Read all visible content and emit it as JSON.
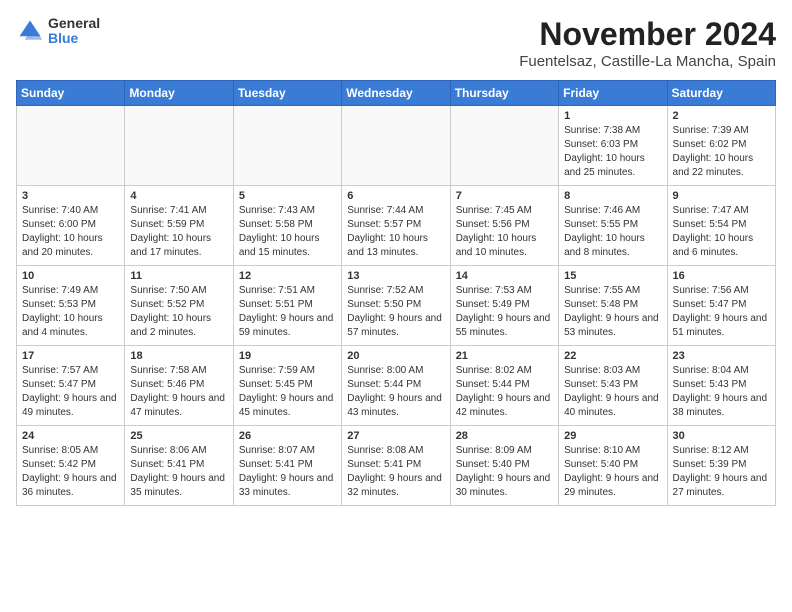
{
  "header": {
    "logo_general": "General",
    "logo_blue": "Blue",
    "month_title": "November 2024",
    "location": "Fuentelsaz, Castille-La Mancha, Spain"
  },
  "days_of_week": [
    "Sunday",
    "Monday",
    "Tuesday",
    "Wednesday",
    "Thursday",
    "Friday",
    "Saturday"
  ],
  "weeks": [
    [
      {
        "day": "",
        "info": "",
        "empty": true
      },
      {
        "day": "",
        "info": "",
        "empty": true
      },
      {
        "day": "",
        "info": "",
        "empty": true
      },
      {
        "day": "",
        "info": "",
        "empty": true
      },
      {
        "day": "",
        "info": "",
        "empty": true
      },
      {
        "day": "1",
        "info": "Sunrise: 7:38 AM\nSunset: 6:03 PM\nDaylight: 10 hours and 25 minutes."
      },
      {
        "day": "2",
        "info": "Sunrise: 7:39 AM\nSunset: 6:02 PM\nDaylight: 10 hours and 22 minutes."
      }
    ],
    [
      {
        "day": "3",
        "info": "Sunrise: 7:40 AM\nSunset: 6:00 PM\nDaylight: 10 hours and 20 minutes."
      },
      {
        "day": "4",
        "info": "Sunrise: 7:41 AM\nSunset: 5:59 PM\nDaylight: 10 hours and 17 minutes."
      },
      {
        "day": "5",
        "info": "Sunrise: 7:43 AM\nSunset: 5:58 PM\nDaylight: 10 hours and 15 minutes."
      },
      {
        "day": "6",
        "info": "Sunrise: 7:44 AM\nSunset: 5:57 PM\nDaylight: 10 hours and 13 minutes."
      },
      {
        "day": "7",
        "info": "Sunrise: 7:45 AM\nSunset: 5:56 PM\nDaylight: 10 hours and 10 minutes."
      },
      {
        "day": "8",
        "info": "Sunrise: 7:46 AM\nSunset: 5:55 PM\nDaylight: 10 hours and 8 minutes."
      },
      {
        "day": "9",
        "info": "Sunrise: 7:47 AM\nSunset: 5:54 PM\nDaylight: 10 hours and 6 minutes."
      }
    ],
    [
      {
        "day": "10",
        "info": "Sunrise: 7:49 AM\nSunset: 5:53 PM\nDaylight: 10 hours and 4 minutes."
      },
      {
        "day": "11",
        "info": "Sunrise: 7:50 AM\nSunset: 5:52 PM\nDaylight: 10 hours and 2 minutes."
      },
      {
        "day": "12",
        "info": "Sunrise: 7:51 AM\nSunset: 5:51 PM\nDaylight: 9 hours and 59 minutes."
      },
      {
        "day": "13",
        "info": "Sunrise: 7:52 AM\nSunset: 5:50 PM\nDaylight: 9 hours and 57 minutes."
      },
      {
        "day": "14",
        "info": "Sunrise: 7:53 AM\nSunset: 5:49 PM\nDaylight: 9 hours and 55 minutes."
      },
      {
        "day": "15",
        "info": "Sunrise: 7:55 AM\nSunset: 5:48 PM\nDaylight: 9 hours and 53 minutes."
      },
      {
        "day": "16",
        "info": "Sunrise: 7:56 AM\nSunset: 5:47 PM\nDaylight: 9 hours and 51 minutes."
      }
    ],
    [
      {
        "day": "17",
        "info": "Sunrise: 7:57 AM\nSunset: 5:47 PM\nDaylight: 9 hours and 49 minutes."
      },
      {
        "day": "18",
        "info": "Sunrise: 7:58 AM\nSunset: 5:46 PM\nDaylight: 9 hours and 47 minutes."
      },
      {
        "day": "19",
        "info": "Sunrise: 7:59 AM\nSunset: 5:45 PM\nDaylight: 9 hours and 45 minutes."
      },
      {
        "day": "20",
        "info": "Sunrise: 8:00 AM\nSunset: 5:44 PM\nDaylight: 9 hours and 43 minutes."
      },
      {
        "day": "21",
        "info": "Sunrise: 8:02 AM\nSunset: 5:44 PM\nDaylight: 9 hours and 42 minutes."
      },
      {
        "day": "22",
        "info": "Sunrise: 8:03 AM\nSunset: 5:43 PM\nDaylight: 9 hours and 40 minutes."
      },
      {
        "day": "23",
        "info": "Sunrise: 8:04 AM\nSunset: 5:43 PM\nDaylight: 9 hours and 38 minutes."
      }
    ],
    [
      {
        "day": "24",
        "info": "Sunrise: 8:05 AM\nSunset: 5:42 PM\nDaylight: 9 hours and 36 minutes."
      },
      {
        "day": "25",
        "info": "Sunrise: 8:06 AM\nSunset: 5:41 PM\nDaylight: 9 hours and 35 minutes."
      },
      {
        "day": "26",
        "info": "Sunrise: 8:07 AM\nSunset: 5:41 PM\nDaylight: 9 hours and 33 minutes."
      },
      {
        "day": "27",
        "info": "Sunrise: 8:08 AM\nSunset: 5:41 PM\nDaylight: 9 hours and 32 minutes."
      },
      {
        "day": "28",
        "info": "Sunrise: 8:09 AM\nSunset: 5:40 PM\nDaylight: 9 hours and 30 minutes."
      },
      {
        "day": "29",
        "info": "Sunrise: 8:10 AM\nSunset: 5:40 PM\nDaylight: 9 hours and 29 minutes."
      },
      {
        "day": "30",
        "info": "Sunrise: 8:12 AM\nSunset: 5:39 PM\nDaylight: 9 hours and 27 minutes."
      }
    ]
  ]
}
